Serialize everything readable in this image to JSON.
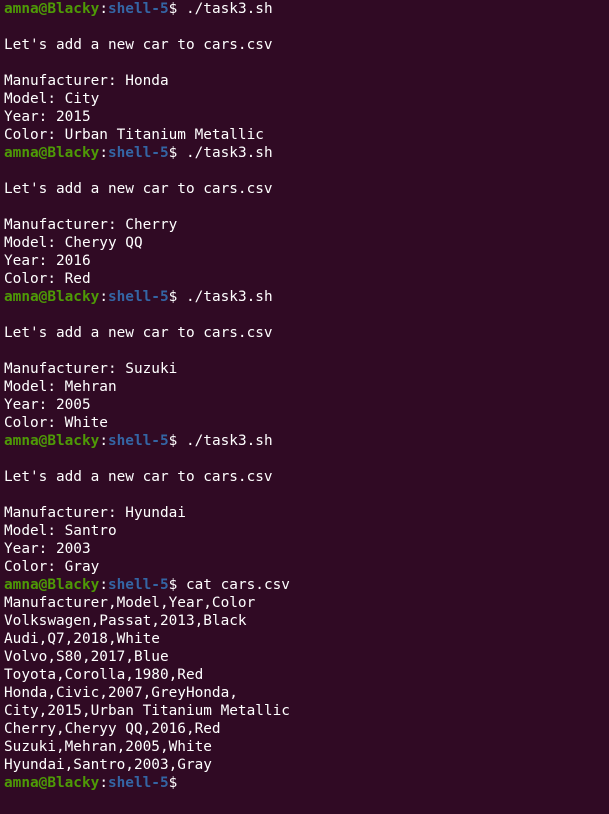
{
  "prompt": {
    "user": "amna@Blacky",
    "colon": ":",
    "path": "shell-5",
    "dollar": "$ "
  },
  "colors": {
    "background": "#300a24",
    "prompt_user": "#4e9a06",
    "prompt_path": "#3465a4",
    "text": "#ffffff"
  },
  "lines": [
    {
      "type": "prompt",
      "cmd": "./task3.sh"
    },
    {
      "type": "out",
      "text": ""
    },
    {
      "type": "out",
      "text": "Let's add a new car to cars.csv"
    },
    {
      "type": "out",
      "text": ""
    },
    {
      "type": "out",
      "text": "Manufacturer: Honda"
    },
    {
      "type": "out",
      "text": "Model: City"
    },
    {
      "type": "out",
      "text": "Year: 2015"
    },
    {
      "type": "out",
      "text": "Color: Urban Titanium Metallic"
    },
    {
      "type": "prompt",
      "cmd": "./task3.sh"
    },
    {
      "type": "out",
      "text": ""
    },
    {
      "type": "out",
      "text": "Let's add a new car to cars.csv"
    },
    {
      "type": "out",
      "text": ""
    },
    {
      "type": "out",
      "text": "Manufacturer: Cherry"
    },
    {
      "type": "out",
      "text": "Model: Cheryy QQ"
    },
    {
      "type": "out",
      "text": "Year: 2016"
    },
    {
      "type": "out",
      "text": "Color: Red"
    },
    {
      "type": "prompt",
      "cmd": "./task3.sh"
    },
    {
      "type": "out",
      "text": ""
    },
    {
      "type": "out",
      "text": "Let's add a new car to cars.csv"
    },
    {
      "type": "out",
      "text": ""
    },
    {
      "type": "out",
      "text": "Manufacturer: Suzuki"
    },
    {
      "type": "out",
      "text": "Model: Mehran"
    },
    {
      "type": "out",
      "text": "Year: 2005"
    },
    {
      "type": "out",
      "text": "Color: White"
    },
    {
      "type": "prompt",
      "cmd": "./task3.sh"
    },
    {
      "type": "out",
      "text": ""
    },
    {
      "type": "out",
      "text": "Let's add a new car to cars.csv"
    },
    {
      "type": "out",
      "text": ""
    },
    {
      "type": "out",
      "text": "Manufacturer: Hyundai"
    },
    {
      "type": "out",
      "text": "Model: Santro"
    },
    {
      "type": "out",
      "text": "Year: 2003"
    },
    {
      "type": "out",
      "text": "Color: Gray"
    },
    {
      "type": "prompt",
      "cmd": "cat cars.csv"
    },
    {
      "type": "out",
      "text": "Manufacturer,Model,Year,Color"
    },
    {
      "type": "out",
      "text": "Volkswagen,Passat,2013,Black"
    },
    {
      "type": "out",
      "text": "Audi,Q7,2018,White"
    },
    {
      "type": "out",
      "text": "Volvo,S80,2017,Blue"
    },
    {
      "type": "out",
      "text": "Toyota,Corolla,1980,Red"
    },
    {
      "type": "out",
      "text": "Honda,Civic,2007,GreyHonda,"
    },
    {
      "type": "out",
      "text": "City,2015,Urban Titanium Metallic"
    },
    {
      "type": "out",
      "text": "Cherry,Cheryy QQ,2016,Red"
    },
    {
      "type": "out",
      "text": "Suzuki,Mehran,2005,White"
    },
    {
      "type": "out",
      "text": "Hyundai,Santro,2003,Gray"
    },
    {
      "type": "prompt",
      "cmd": ""
    }
  ]
}
